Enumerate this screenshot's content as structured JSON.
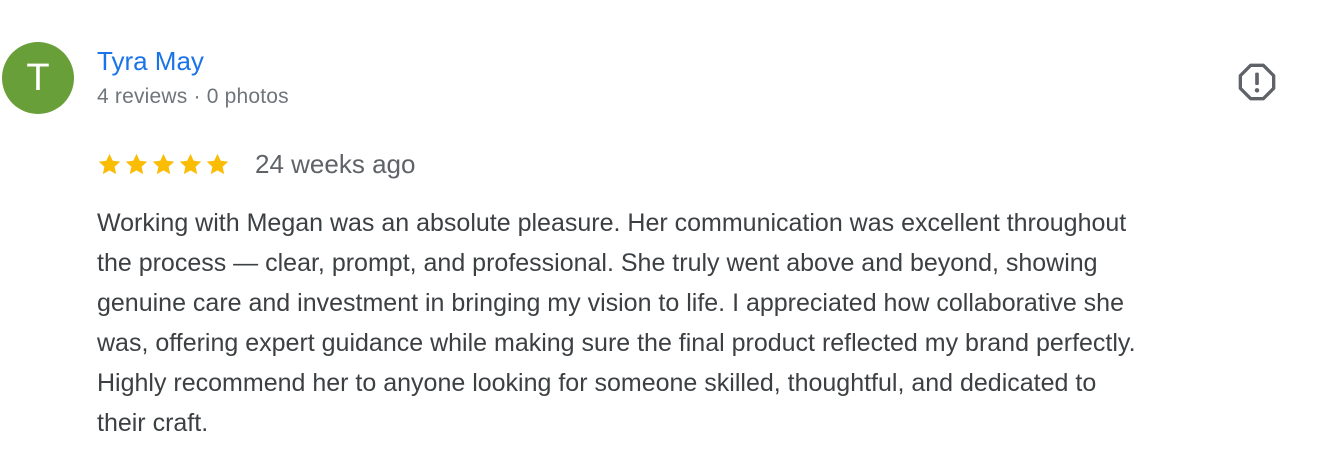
{
  "reviewer": {
    "initial": "T",
    "name": "Tyra May",
    "review_count": "4 reviews",
    "separator": "·",
    "photo_count": "0 photos"
  },
  "rating": {
    "stars": 5,
    "max_stars": 5,
    "date": "24 weeks ago"
  },
  "review": {
    "text": "Working with Megan was an absolute pleasure. Her communication was excellent throughout\nthe process — clear, prompt, and professional. She truly went above and beyond, showing\ngenuine care and investment in bringing my vision to life. I appreciated how collaborative she\nwas, offering expert guidance while making sure the final product reflected my brand perfectly.\nHighly recommend her to anyone looking for someone skilled, thoughtful, and dedicated to\ntheir craft."
  },
  "icons": {
    "report": "report-flag-icon",
    "star": "star-icon"
  },
  "colors": {
    "avatar_bg": "#689f38",
    "name_link": "#1a73e8",
    "star_fill": "#fbbc04",
    "report_icon": "#5f6368",
    "meta_text": "#70757a",
    "body_text": "#3c4043"
  }
}
